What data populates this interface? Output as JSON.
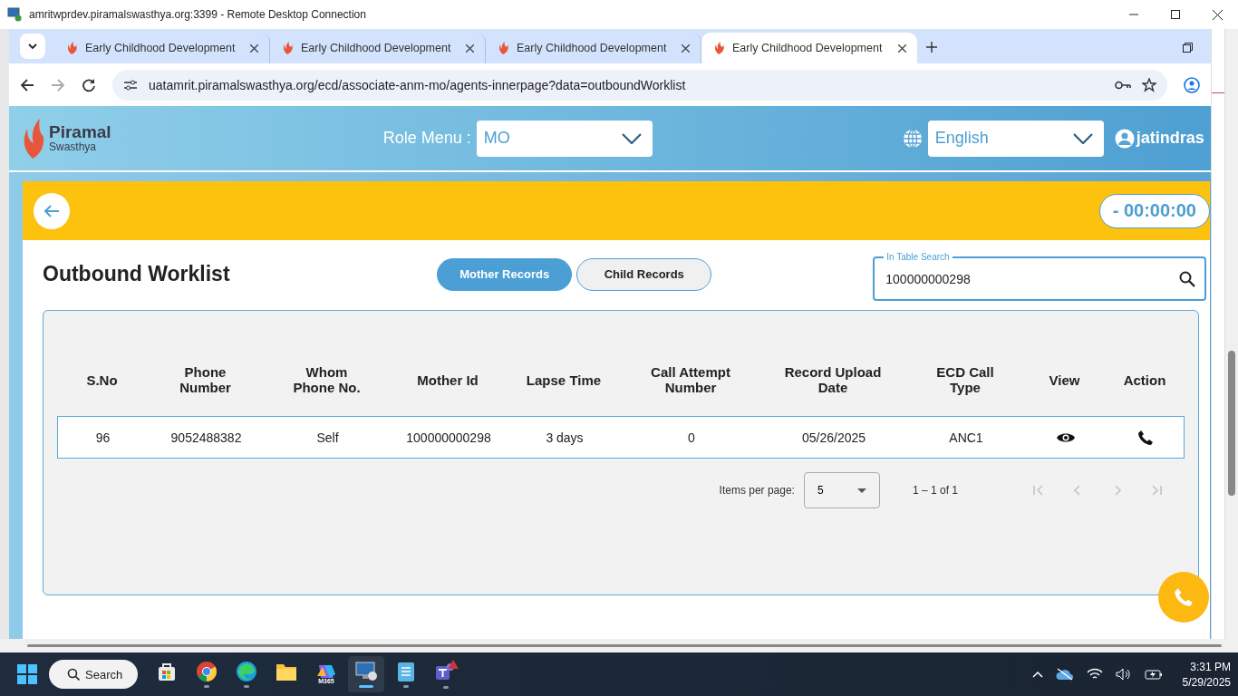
{
  "window": {
    "title": "amritwprdev.piramalswasthya.org:3399 - Remote Desktop Connection"
  },
  "browser": {
    "tabs": [
      {
        "label": "Early Childhood Development",
        "selected": false
      },
      {
        "label": "Early Childhood Development",
        "selected": false
      },
      {
        "label": "Early Childhood Development",
        "selected": false
      },
      {
        "label": "Early Childhood Development",
        "selected": true
      }
    ],
    "url": "uatamrit.piramalswasthya.org/ecd/associate-anm-mo/agents-innerpage?data=outboundWorklist",
    "forward_disabled": true
  },
  "header": {
    "logo_name": "Piramal",
    "logo_sub": "Swasthya",
    "role_label": "Role Menu :",
    "role_value": "MO",
    "language": "English",
    "user": "jatindras"
  },
  "timer": "- 00:00:00",
  "page_title": "Outbound Worklist",
  "record_tabs": [
    {
      "label": "Mother Records",
      "selected": true
    },
    {
      "label": "Child Records",
      "selected": false
    }
  ],
  "search": {
    "label": "In Table Search",
    "value": "100000000298"
  },
  "table": {
    "columns": [
      "S.No",
      "Phone Number",
      "Whom Phone No.",
      "Mother Id",
      "Lapse Time",
      "Call Attempt Number",
      "Record Upload Date",
      "ECD Call Type",
      "View",
      "Action"
    ],
    "rows": [
      {
        "cells": [
          "96",
          "9052488382",
          "Self",
          "100000000298",
          "3 days",
          "0",
          "05/26/2025",
          "ANC1"
        ]
      }
    ]
  },
  "paginator": {
    "label": "Items per page:",
    "page_size": "5",
    "range": "1 – 1 of 1",
    "buttons": [
      {
        "kind": "first",
        "disabled": true
      },
      {
        "kind": "prev",
        "disabled": true
      },
      {
        "kind": "next",
        "disabled": true
      },
      {
        "kind": "last",
        "disabled": true
      }
    ]
  },
  "taskbar": {
    "search": "Search",
    "apps": [
      {
        "kind": "store",
        "running": false,
        "selected": false
      },
      {
        "kind": "chrome",
        "running": true,
        "selected": false
      },
      {
        "kind": "edge",
        "running": true,
        "selected": false
      },
      {
        "kind": "files",
        "running": false,
        "selected": false
      },
      {
        "kind": "m365",
        "label": "M365",
        "running": false,
        "selected": false
      },
      {
        "kind": "rdp",
        "running": true,
        "selected": true
      },
      {
        "kind": "notepad",
        "running": true,
        "selected": false
      },
      {
        "kind": "teams",
        "running": true,
        "selected": false
      }
    ],
    "time": "3:31 PM",
    "date": "5/29/2025"
  }
}
